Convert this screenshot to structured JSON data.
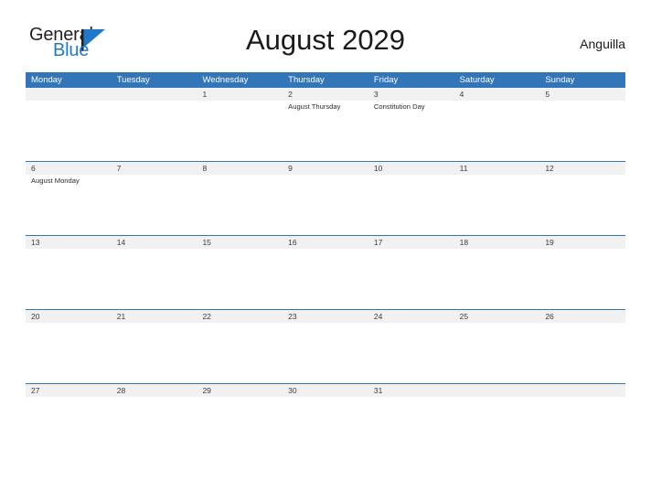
{
  "brand": {
    "name_part1": "General",
    "name_part2": "Blue",
    "flag_icon": "blue-triangle-flag-icon",
    "accent_color": "#2079c7"
  },
  "header": {
    "title": "August 2029",
    "region": "Anguilla"
  },
  "theme": {
    "header_blue": "#3275b9",
    "date_band_gray": "#f1f1f1",
    "row_divider_blue": "#3275b9",
    "text_dark": "#1a1a1a"
  },
  "calendar": {
    "month": "August",
    "year": "2029",
    "weekdays": [
      {
        "label": "Monday"
      },
      {
        "label": "Tuesday"
      },
      {
        "label": "Wednesday"
      },
      {
        "label": "Thursday"
      },
      {
        "label": "Friday"
      },
      {
        "label": "Saturday"
      },
      {
        "label": "Sunday"
      }
    ],
    "weeks": [
      {
        "days": [
          {
            "date": "",
            "events": []
          },
          {
            "date": "",
            "events": []
          },
          {
            "date": "1",
            "events": []
          },
          {
            "date": "2",
            "events": [
              "August Thursday"
            ]
          },
          {
            "date": "3",
            "events": [
              "Constitution Day"
            ]
          },
          {
            "date": "4",
            "events": []
          },
          {
            "date": "5",
            "events": []
          }
        ]
      },
      {
        "days": [
          {
            "date": "6",
            "events": [
              "August Monday"
            ]
          },
          {
            "date": "7",
            "events": []
          },
          {
            "date": "8",
            "events": []
          },
          {
            "date": "9",
            "events": []
          },
          {
            "date": "10",
            "events": []
          },
          {
            "date": "11",
            "events": []
          },
          {
            "date": "12",
            "events": []
          }
        ]
      },
      {
        "days": [
          {
            "date": "13",
            "events": []
          },
          {
            "date": "14",
            "events": []
          },
          {
            "date": "15",
            "events": []
          },
          {
            "date": "16",
            "events": []
          },
          {
            "date": "17",
            "events": []
          },
          {
            "date": "18",
            "events": []
          },
          {
            "date": "19",
            "events": []
          }
        ]
      },
      {
        "days": [
          {
            "date": "20",
            "events": []
          },
          {
            "date": "21",
            "events": []
          },
          {
            "date": "22",
            "events": []
          },
          {
            "date": "23",
            "events": []
          },
          {
            "date": "24",
            "events": []
          },
          {
            "date": "25",
            "events": []
          },
          {
            "date": "26",
            "events": []
          }
        ]
      },
      {
        "days": [
          {
            "date": "27",
            "events": []
          },
          {
            "date": "28",
            "events": []
          },
          {
            "date": "29",
            "events": []
          },
          {
            "date": "30",
            "events": []
          },
          {
            "date": "31",
            "events": []
          },
          {
            "date": "",
            "events": []
          },
          {
            "date": "",
            "events": []
          }
        ]
      }
    ]
  }
}
